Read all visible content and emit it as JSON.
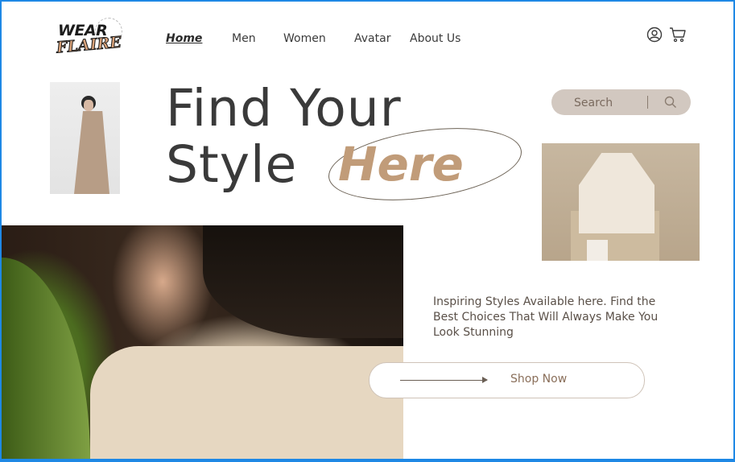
{
  "logo": {
    "line1": "WEAR",
    "line2": "FLAIRE"
  },
  "nav": {
    "items": [
      {
        "label": "Home",
        "active": true
      },
      {
        "label": "Men",
        "active": false
      },
      {
        "label": "Women",
        "active": false
      },
      {
        "label": "Avatar",
        "active": false
      },
      {
        "label": "About Us",
        "active": false
      }
    ]
  },
  "header_icons": {
    "account": "user-icon",
    "cart": "cart-icon"
  },
  "hero": {
    "title_line1": "Find Your",
    "title_line2": "Style",
    "title_highlight": "Here"
  },
  "search": {
    "placeholder": "Search",
    "icon": "search-icon"
  },
  "description": "Inspiring Styles Available here. Find the Best Choices That Will Always Make You Look Stunning",
  "cta": {
    "label": "Shop Now"
  },
  "colors": {
    "accent": "#c19c79",
    "text": "#3a3a3a",
    "search_bg": "#d2c8c0",
    "frame": "#1e88e5"
  }
}
